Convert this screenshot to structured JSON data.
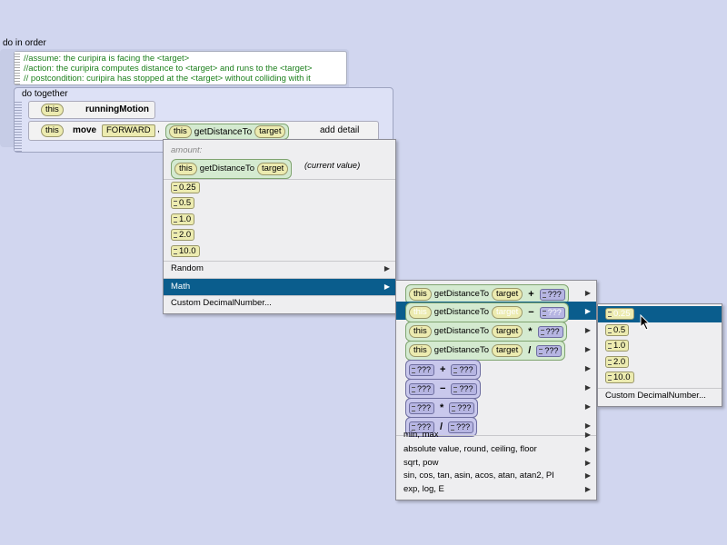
{
  "do_in_order": {
    "label": "do in order"
  },
  "comment": {
    "lines": [
      "//assume: the curipira is facing the <target>",
      "//action: the curipira computes distance to <target> and runs to the <target>",
      "// postcondition: curipira has stopped at the <target> without colliding with it"
    ]
  },
  "do_together": {
    "label": "do together"
  },
  "stmt1": {
    "this": "this",
    "method": "runningMotion"
  },
  "stmt2": {
    "this": "this",
    "verb": "move",
    "direction": "FORWARD",
    "comma": ",",
    "this2": "this",
    "func": "getDistanceTo",
    "arg": "target",
    "add_detail": "add detail"
  },
  "menu1": {
    "header": "amount:",
    "current": {
      "this": "this",
      "func": "getDistanceTo",
      "arg": "target",
      "note": "(current value)"
    },
    "values": [
      "0.25",
      "0.5",
      "1.0",
      "2.0",
      "10.0"
    ],
    "random": "Random",
    "math": "Math",
    "custom": "Custom DecimalNumber..."
  },
  "menu2": {
    "expr_rows": [
      {
        "this": "this",
        "func": "getDistanceTo",
        "arg": "target",
        "op": "+",
        "q": "???"
      },
      {
        "this": "this",
        "func": "getDistanceTo",
        "arg": "target",
        "op": "−",
        "q": "???"
      },
      {
        "this": "this",
        "func": "getDistanceTo",
        "arg": "target",
        "op": "*",
        "q": "???"
      },
      {
        "this": "this",
        "func": "getDistanceTo",
        "arg": "target",
        "op": "/",
        "q": "???"
      }
    ],
    "q_rows": [
      {
        "a": "???",
        "op": "+",
        "b": "???"
      },
      {
        "a": "???",
        "op": "−",
        "b": "???"
      },
      {
        "a": "???",
        "op": "*",
        "b": "???"
      },
      {
        "a": "???",
        "op": "/",
        "b": "???"
      }
    ],
    "text_items": [
      "min, max",
      "absolute value, round, ceiling, floor",
      "sqrt, pow",
      "sin, cos, tan, asin, acos, atan, atan2, PI",
      "exp, log, E"
    ]
  },
  "menu3": {
    "values": [
      "0.25",
      "0.5",
      "1.0",
      "2.0",
      "10.0"
    ],
    "custom": "Custom DecimalNumber..."
  }
}
